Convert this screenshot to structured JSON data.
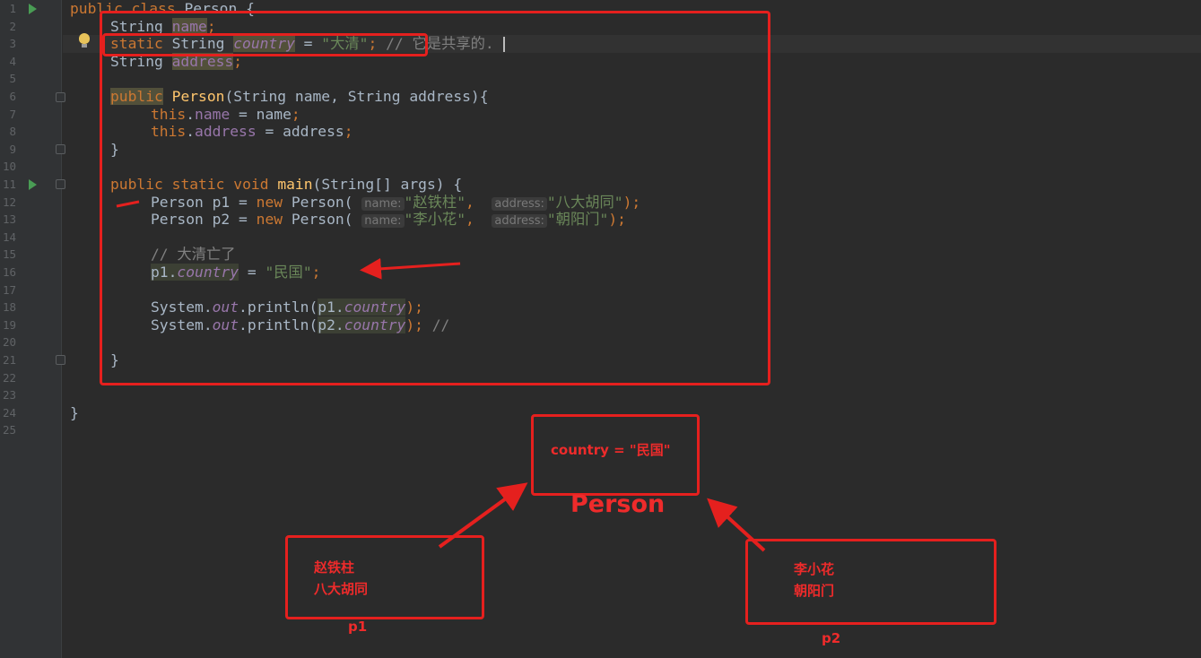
{
  "editor": {
    "line_numbers": [
      "1",
      "2",
      "3",
      "4",
      "5",
      "6",
      "7",
      "8",
      "9",
      "10",
      "11",
      "12",
      "13",
      "14",
      "15",
      "16",
      "17",
      "18",
      "19",
      "20",
      "21",
      "22",
      "23",
      "24",
      "25"
    ],
    "lines": {
      "l1": [
        "public",
        " ",
        "class",
        " Person {"
      ],
      "l2": [
        "String ",
        "name",
        ";"
      ],
      "l3": [
        "static",
        " String ",
        "country",
        " = ",
        "\"大清\"",
        ";",
        " // 它是共享的."
      ],
      "l4": [
        "String ",
        "address",
        ";"
      ],
      "l6": [
        "public",
        " ",
        "Person",
        "(String name, String address){"
      ],
      "l7": [
        "this",
        ".",
        "name",
        " = name",
        ";"
      ],
      "l8": [
        "this",
        ".",
        "address",
        " = address",
        ";"
      ],
      "l9": [
        "}"
      ],
      "l11": [
        "public",
        " ",
        "static",
        " ",
        "void",
        " ",
        "main",
        "(String[] args) {"
      ],
      "l12": [
        "Person p1 = ",
        "new",
        " Person( ",
        "name:",
        "\"赵铁柱\"",
        ",  ",
        "address:",
        "\"八大胡同\"",
        ");"
      ],
      "l13": [
        "Person p2 = ",
        "new",
        " Person( ",
        "name:",
        "\"李小花\"",
        ",  ",
        "address:",
        "\"朝阳门\"",
        ");"
      ],
      "l15": [
        "// 大清亡了"
      ],
      "l16": [
        "p1.",
        "country",
        " = ",
        "\"民国\"",
        ";"
      ],
      "l18": [
        "System.",
        "out",
        ".println(",
        "p1.",
        "country",
        ");"
      ],
      "l19": [
        "System.",
        "out",
        ".println(",
        "p2.",
        "country",
        ");",
        " //"
      ],
      "l21": [
        "}"
      ],
      "l24": [
        "}"
      ]
    }
  },
  "diagram": {
    "class_box": "country = \"民国\"",
    "class_label": "Person",
    "p1_name": "赵铁柱",
    "p1_addr": "八大胡同",
    "p1_label": "p1",
    "p2_name": "李小花",
    "p2_addr": "朝阳门",
    "p2_label": "p2"
  },
  "colors": {
    "background": "#2b2b2b",
    "gutter": "#313335",
    "keyword": "#cc7832",
    "string": "#6a8759",
    "field": "#9876aa",
    "method": "#ffc66d",
    "annotation_red": "#e5201e"
  }
}
